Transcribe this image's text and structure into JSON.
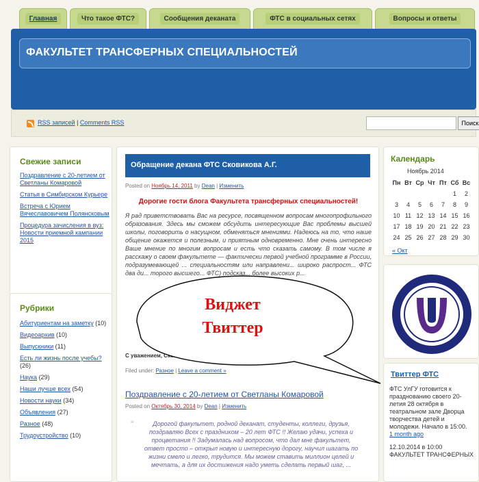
{
  "tabs": [
    {
      "label": "Главная",
      "active": true
    },
    {
      "label": "Что такое ФТС?"
    },
    {
      "label": "Сообщения деканата"
    },
    {
      "label": "ФТС в социальных сетях"
    },
    {
      "label": "Вопросы и ответы"
    }
  ],
  "header": {
    "title": "ФАКУЛЬТЕТ ТРАНСФЕРНЫХ СПЕЦИАЛЬНОСТЕЙ"
  },
  "rss": {
    "entries": "RSS записей",
    "sep": " | ",
    "comments": "Comments RSS"
  },
  "search": {
    "button": "Поиск",
    "value": ""
  },
  "recent": {
    "title": "Свежие записи",
    "items": [
      "Поздравление с 20-летием от Светланы Комаровой",
      "Статья в Симбирском Курьере",
      "Встреча с Юрием Вячеславовичем Полянсковым",
      "Процедура зачисления в вуз: Новости приемной кампании 2015"
    ]
  },
  "categories": {
    "title": "Рубрики",
    "items": [
      {
        "name": "Абитуриентам на заметку",
        "count": "(10)"
      },
      {
        "name": "Видеоархив",
        "count": "(10)"
      },
      {
        "name": "Выпускники",
        "count": "(11)"
      },
      {
        "name": "Есть ли жизнь после учебы?",
        "count": "(26)"
      },
      {
        "name": "Наука",
        "count": "(29)"
      },
      {
        "name": "Наши лучше всех",
        "count": "(54)"
      },
      {
        "name": "Новости науки",
        "count": "(34)"
      },
      {
        "name": "Объявления",
        "count": "(27)"
      },
      {
        "name": "Разное",
        "count": "(48)"
      },
      {
        "name": "Трудоустройство",
        "count": "(10)"
      }
    ]
  },
  "post1": {
    "title": "Обращение декана ФТС Сковикова А.Г.",
    "posted_on": "Posted on",
    "date": "Ноябрь 14, 2011",
    "by": "by",
    "author": "Dean",
    "edit": "Изменить",
    "heading": "Дорогие гости блога Факультета трансферных специальностей!",
    "body": "Я рад приветствовать Вас на ресурсе, посвященном вопросам многопрофильного образования. Здесь мы сможем обсудить интересующие Вас проблемы высшей школы, поговорить о насущном, обменяться мнениями. Надеюсь на то, что наше общение окажется и полезным, и приятным одновременно. Мне очень интересно Ваше мнение по многим вопросам и есть что сказать самому. В том числе я расскажу о своем факультете — фактически первой учебной программе в России, подразумевающей ... специальностям или направлени... широко распрост... ФТС два ди... торого высшего... ФТС) подсказ... более высоких р...",
    "signature": "С уважением, Сков...",
    "filed_under": "Filed under:",
    "category": "Разное",
    "comment": "Leave a comment »"
  },
  "post2": {
    "title": "Поздравление с 20-летием от Светланы Комаровой",
    "posted_on": "Posted on",
    "date": "Октябрь 30, 2014",
    "by": "by",
    "author": "Dean",
    "edit": "Изменить",
    "body": "Дорогой факультет, родной деканат, студенты, коллеги, друзья, поздравляю Всех с праздником – 20 лет ФТС !! Желаю удачи, успеха и процветания !! Задумалась над вопросом, что дал мне факультет, ответ просто – открыл новую и интересную дорогу, научил шагать по жизни смело и легко, трудится. Мы можем ставить миллион целей и мечтать, а для их достижения надо уметь сделать первый шаг, ..."
  },
  "calendar": {
    "title": "Календарь",
    "month": "Ноябрь 2014",
    "headers": [
      "Пн",
      "Вт",
      "Ср",
      "Чт",
      "Пт",
      "Сб",
      "Вс"
    ],
    "rows": [
      [
        "",
        "",
        "",
        "",
        "",
        "1",
        "2"
      ],
      [
        "3",
        "4",
        "5",
        "6",
        "7",
        "8",
        "9"
      ],
      [
        "10",
        "11",
        "12",
        "13",
        "14",
        "15",
        "16"
      ],
      [
        "17",
        "18",
        "19",
        "20",
        "21",
        "22",
        "23"
      ],
      [
        "24",
        "25",
        "26",
        "27",
        "28",
        "29",
        "30"
      ]
    ],
    "prev": "« Окт"
  },
  "logo": {
    "text": "ULYANOVSK STATE UNIVERSITY · УЛЬЯНОВСКИЙ ГОСУДАРСТВЕННЫЙ УНИВЕРСИТЕТ"
  },
  "twitter": {
    "title": "Твиттер ФТС",
    "tweet1": "ФТС УлГУ готовится к празднованию своего 20-летия 28 октября в театральном зале Дворца творчества детей и молодежи. Начало в 15:00.",
    "tweet1_time": "1 month ago",
    "tweet2": "12.10.2014 в 10:00 ФАКУЛЬТЕТ ТРАНСФЕРНЫХ"
  },
  "callout": {
    "line1": "Виджет",
    "line2": "Твиттер"
  },
  "colors": {
    "accent": "#1e5fa8",
    "tab": "#c6d98f",
    "widget_title": "#5a8a1a",
    "callout_text": "#e01010"
  }
}
